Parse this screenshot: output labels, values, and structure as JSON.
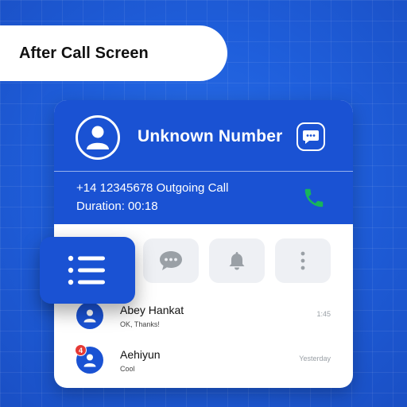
{
  "banner": {
    "title": "After Call Screen"
  },
  "contact": {
    "name": "Unknown Number",
    "avatar_icon": "user-icon",
    "message_icon": "chat-bubble-icon"
  },
  "call": {
    "summary": "+14 12345678 Outgoing Call",
    "duration": "Duration: 00:18",
    "call_icon": "phone-icon"
  },
  "actions": [
    {
      "icon": "chat-icon"
    },
    {
      "icon": "bell-icon"
    },
    {
      "icon": "more-vertical-icon"
    }
  ],
  "menu_fab": {
    "icon": "list-icon"
  },
  "recent": [
    {
      "name": "Abey Hankat",
      "preview": "OK, Thanks!",
      "time": "1:45",
      "badge": ""
    },
    {
      "name": "Aehiyun",
      "preview": "Cool",
      "time": "Yesterday",
      "badge": "4"
    }
  ],
  "colors": {
    "background": "#1f5fdc",
    "header": "#1a52d3",
    "call_green": "#17b55a",
    "badge_red": "#e53935"
  }
}
